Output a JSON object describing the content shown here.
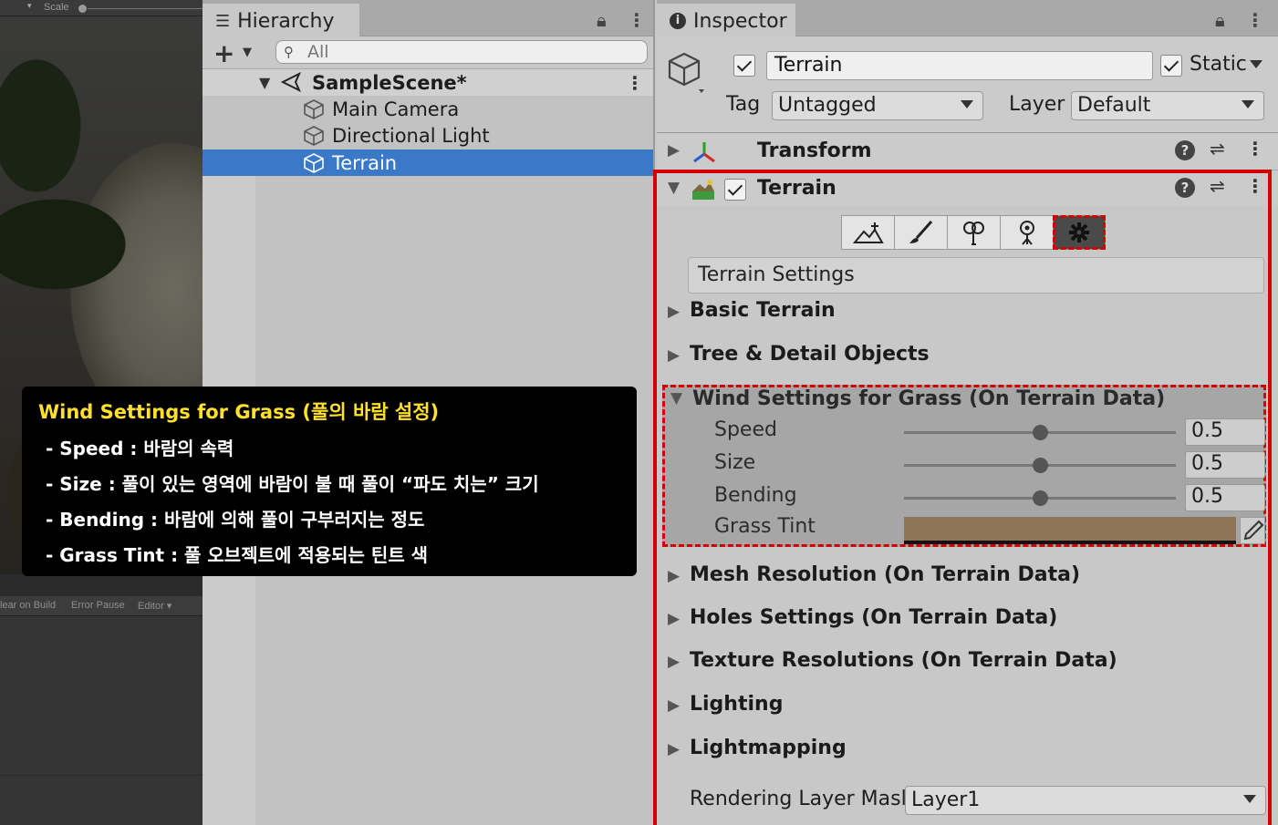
{
  "scene": {
    "scale_label": "Scale",
    "console_buttons": [
      "lear on Build",
      "Error Pause",
      "Editor"
    ]
  },
  "hierarchy": {
    "tab_label": "Hierarchy",
    "search_placeholder": "All",
    "scene_name": "SampleScene*",
    "items": [
      {
        "name": "Main Camera",
        "selected": false
      },
      {
        "name": "Directional Light",
        "selected": false
      },
      {
        "name": "Terrain",
        "selected": true
      }
    ]
  },
  "caption": {
    "title": "Wind Settings for Grass (풀의 바람 설정)",
    "lines": [
      "- Speed : 바람의 속력",
      "- Size : 풀이 있는 영역에 바람이 불 때 풀이 “파도 치는” 크기",
      "- Bending : 바람에 의해 풀이 구부러지는 정도",
      "- Grass Tint : 풀 오브젝트에 적용되는 틴트 색"
    ]
  },
  "inspector": {
    "tab_label": "Inspector",
    "object_name": "Terrain",
    "static_label": "Static",
    "tag_label": "Tag",
    "tag_value": "Untagged",
    "layer_label": "Layer",
    "layer_value": "Default",
    "transform_title": "Transform",
    "terrain_title": "Terrain",
    "settings_header": "Terrain Settings",
    "sections": {
      "basic": "Basic Terrain",
      "tree": "Tree & Detail Objects",
      "wind": "Wind Settings for Grass (On Terrain Data)",
      "mesh": "Mesh Resolution (On Terrain Data)",
      "holes": "Holes Settings (On Terrain Data)",
      "texture": "Texture Resolutions (On Terrain Data)",
      "lighting": "Lighting",
      "lightmapping": "Lightmapping"
    },
    "wind": {
      "speed_label": "Speed",
      "speed_value": "0.5",
      "speed": 0.5,
      "size_label": "Size",
      "size_value": "0.5",
      "size": 0.5,
      "bending_label": "Bending",
      "bending_value": "0.5",
      "bending": 0.5,
      "tint_label": "Grass Tint",
      "tint_color": "#8e7557"
    },
    "rendering_label": "Rendering Layer Masl",
    "rendering_value": "Layer1"
  },
  "colors": {
    "selection": "#3a78c8",
    "highlight_frame": "#d40000",
    "caption_title": "#ffe02a"
  }
}
